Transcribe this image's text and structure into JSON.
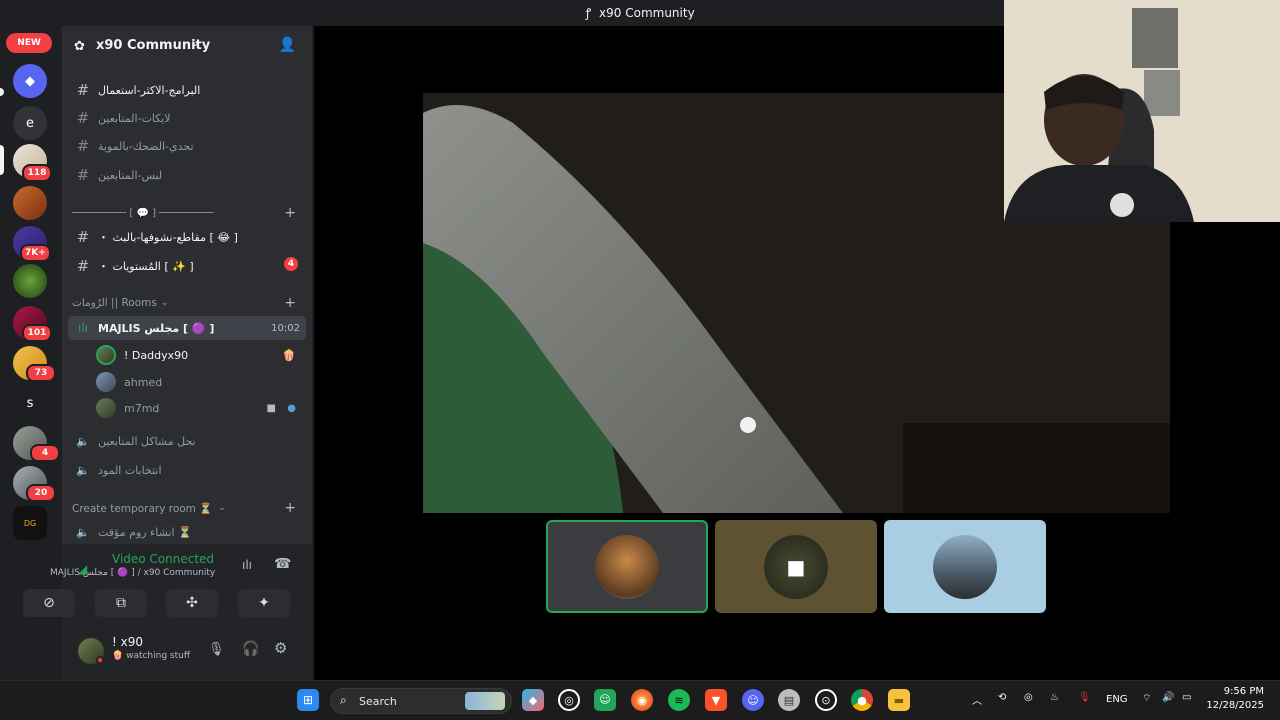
{
  "window": {
    "title": "x90 Community"
  },
  "rail": {
    "new_badge": "NEW",
    "servers": [
      {
        "letter": "",
        "badge": ""
      },
      {
        "letter": "e",
        "badge": ""
      },
      {
        "letter": "",
        "badge": "118"
      },
      {
        "letter": "",
        "badge": ""
      },
      {
        "letter": "",
        "badge": "7K+"
      },
      {
        "letter": "",
        "badge": ""
      },
      {
        "letter": "",
        "badge": "101"
      },
      {
        "letter": "",
        "badge": "73"
      },
      {
        "letter": "s",
        "badge": ""
      },
      {
        "letter": "",
        "badge": "4"
      },
      {
        "letter": "",
        "badge": "20"
      },
      {
        "letter": "",
        "badge": ""
      }
    ]
  },
  "server": {
    "name": "x90 Community"
  },
  "channels": {
    "text": [
      {
        "name": "البرامج-الاكثر-استعمال",
        "unread": true
      },
      {
        "name": "لايكات-المتابعين",
        "unread": false
      },
      {
        "name": "تحدي-الضحك-بالموية",
        "unread": false
      },
      {
        "name": "لبس-المتابعين",
        "unread": false
      }
    ],
    "divider_label": "───────── [ 💬 ] ─────────",
    "special": [
      {
        "name": "・ مقاطع-نشوفها-بالبث [ 😂 ]",
        "badge": ""
      },
      {
        "name": "・ المُستويات [ ✨ ]",
        "badge": "4"
      }
    ],
    "rooms_category": "الرُومات || Rooms",
    "voice_active": {
      "name": "MAJLIS مجلس [ 🟣 ]",
      "time": "10:02"
    },
    "members": [
      {
        "name": "! Daddyx90",
        "color": "#f2f3f5"
      },
      {
        "name": "ahmed",
        "color": "#949ba4"
      },
      {
        "name": "m7md",
        "color": "#949ba4"
      }
    ],
    "voice_more": [
      {
        "name": "نحل مشاكل المتابعين"
      },
      {
        "name": "انتخابات المود"
      }
    ],
    "temp_category": "Create temporary room ⏳",
    "temp_channel": "انشاء روم مؤقت ⏳"
  },
  "voice": {
    "status": "Video Connected",
    "location": "MAJLIS مجلس [ 🟣 ] / x90 Community"
  },
  "user": {
    "name": "! x90",
    "status": "watching stuff"
  },
  "taskbar": {
    "search_placeholder": "Search",
    "lang": "ENG",
    "time": "9:56 PM",
    "date": "12/28/2025"
  },
  "colors": {
    "accent_green": "#23a55a",
    "badge_red": "#f23f43",
    "sidebar": "#2b2d31"
  }
}
